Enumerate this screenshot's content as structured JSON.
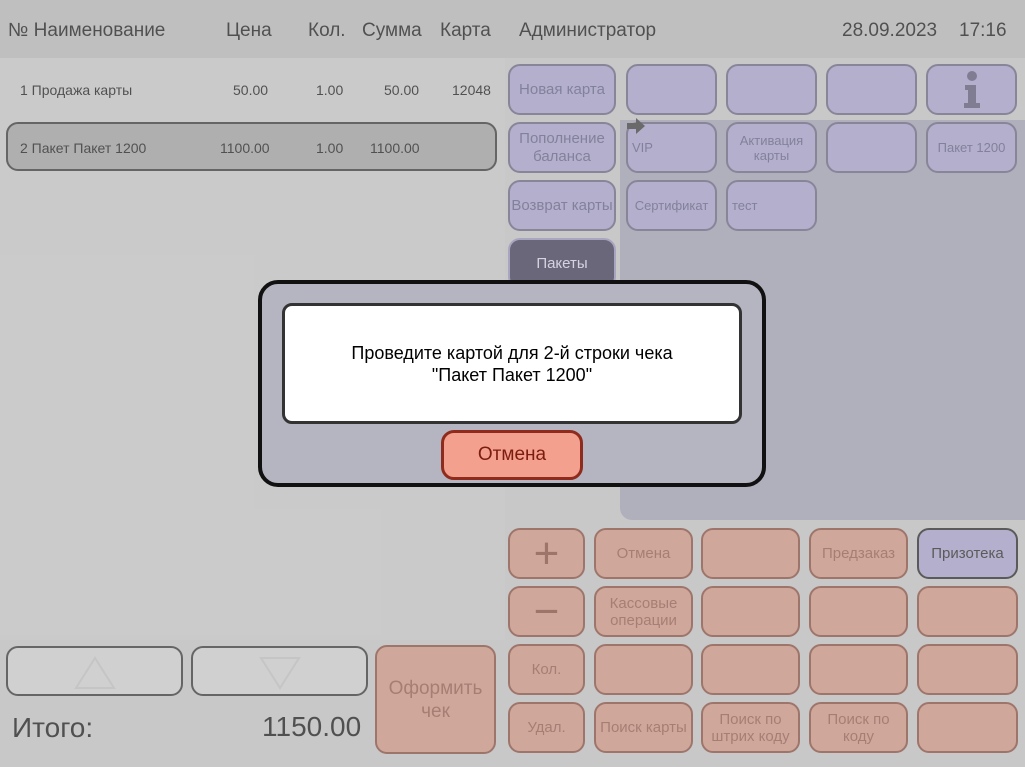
{
  "header": {
    "col_no_name": "№ Наименование",
    "col_price": "Цена",
    "col_qty": "Кол.",
    "col_sum": "Сумма",
    "col_card": "Карта",
    "user": "Администратор",
    "date": "28.09.2023",
    "time": "17:16"
  },
  "receipt": {
    "rows": [
      {
        "name": "1 Продажа карты",
        "price": "50.00",
        "qty": "1.00",
        "sum": "50.00",
        "card": "12048"
      },
      {
        "name": "2 Пакет Пакет 1200",
        "price": "1100.00",
        "qty": "1.00",
        "sum": "1100.00",
        "card": ""
      }
    ]
  },
  "categories": {
    "new_card": "Новая карта",
    "top_up": "Пополнение баланса",
    "return_card": "Возврат карты",
    "packages": "Пакеты"
  },
  "tiles": {
    "vip": "VIP",
    "activation": "Активация карты",
    "package_1200": "Пакет 1200",
    "certificate": "Сертификат",
    "test": "тест",
    "info_icon": "info-icon",
    "arrow_icon": "arrow-right-icon"
  },
  "keypad": {
    "plus": "+",
    "minus": "−",
    "cancel": "Отмена",
    "preorder": "Предзаказ",
    "prizoteka": "Призотека",
    "cash_ops": "Кассовые операции",
    "qty": "Кол.",
    "delete": "Удал.",
    "find_card": "Поиск карты",
    "find_barcode": "Поиск по штрих коду",
    "find_code": "Поиск по коду",
    "checkout": "Оформить чек"
  },
  "totals": {
    "label": "Итого:",
    "value": "1150.00"
  },
  "dialog": {
    "line1": "Проведите картой для 2-й строки чека",
    "line2": "\"Пакет Пакет 1200\"",
    "cancel": "Отмена"
  },
  "colors": {
    "tile_violet": "#a09ac8",
    "key_orange": "#cf8f79",
    "dialog_cancel": "#f4a08e"
  }
}
